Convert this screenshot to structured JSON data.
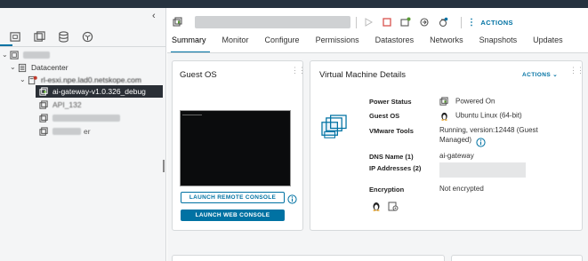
{
  "sidebar": {
    "collapse_icon": "chevron-left-icon",
    "view_tabs": [
      {
        "icon": "hosts-clusters-icon"
      },
      {
        "icon": "vms-templates-icon"
      },
      {
        "icon": "storage-icon"
      },
      {
        "icon": "networking-icon"
      }
    ],
    "tree": {
      "root_label": "",
      "datacenter_label": "Datacenter",
      "host_label": "rl-esxi.npe.lad0.netskope.com",
      "vms": [
        {
          "label": "ai-gateway-v1.0.326_debug",
          "selected": true
        },
        {
          "label": "API_132",
          "selected": false
        },
        {
          "label": "",
          "selected": false
        },
        {
          "label": "er",
          "selected": false
        }
      ]
    }
  },
  "header": {
    "vm_name": "",
    "actions_label": "ACTIONS",
    "action_icons": [
      "power-on-icon",
      "power-off-icon",
      "suspend-icon",
      "migrate-icon",
      "snapshot-icon"
    ]
  },
  "tabs": [
    "Summary",
    "Monitor",
    "Configure",
    "Permissions",
    "Datastores",
    "Networks",
    "Snapshots",
    "Updates"
  ],
  "guest_os": {
    "title": "Guest OS",
    "launch_remote_label": "LAUNCH REMOTE CONSOLE",
    "launch_web_label": "LAUNCH WEB CONSOLE"
  },
  "vm_details": {
    "title": "Virtual Machine Details",
    "actions_label": "ACTIONS",
    "power_status_label": "Power Status",
    "power_status_value": "Powered On",
    "guest_os_label": "Guest OS",
    "guest_os_value": "Ubuntu Linux (64-bit)",
    "vmware_tools_label": "VMware Tools",
    "vmware_tools_value_line1": "Running, version:12448 (Guest",
    "vmware_tools_value_line2": "Managed)",
    "dns_label": "DNS Name (1)",
    "dns_value": "ai-gateway",
    "ip_label": "IP Addresses (2)",
    "encryption_label": "Encryption",
    "encryption_value": "Not encrypted"
  },
  "colors": {
    "accent": "#0072a3",
    "topbar": "#26323f",
    "vm_green": "#5a9a36"
  }
}
